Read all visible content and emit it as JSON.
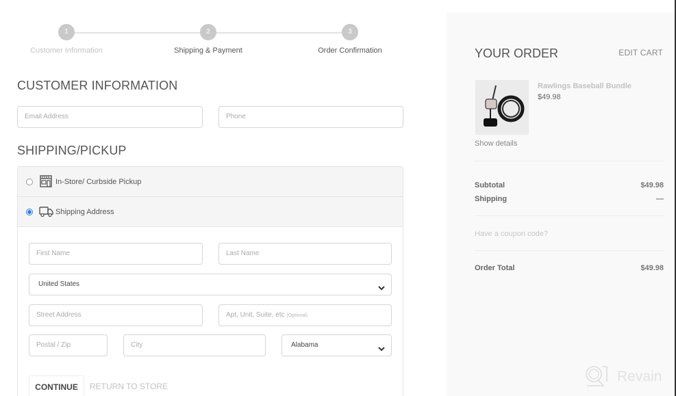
{
  "steps": [
    {
      "number": "1",
      "label": "Customer Information",
      "state": "done"
    },
    {
      "number": "2",
      "label": "Shipping & Payment",
      "state": "current"
    },
    {
      "number": "3",
      "label": "Order Confirmation",
      "state": "upcoming"
    }
  ],
  "customer": {
    "heading": "CUSTOMER INFORMATION",
    "email_placeholder": "Email Address",
    "phone_placeholder": "Phone"
  },
  "shipping": {
    "heading": "SHIPPING/PICKUP",
    "options": [
      {
        "label": "In-Store/ Curbside Pickup",
        "icon": "storefront-icon",
        "selected": false
      },
      {
        "label": "Shipping Address",
        "icon": "truck-icon",
        "selected": true
      }
    ],
    "first_name_placeholder": "First Name",
    "last_name_placeholder": "Last Name",
    "country_value": "United States",
    "street_placeholder": "Street Address",
    "apt_placeholder": "Apt, Unit, Suite, etc",
    "apt_optional": "(Optional)",
    "postal_placeholder": "Postal / Zip",
    "city_placeholder": "City",
    "state_value": "Alabama"
  },
  "actions": {
    "continue_label": "CONTINUE",
    "return_label": "RETURN TO STORE"
  },
  "order": {
    "title": "YOUR ORDER",
    "edit_label": "EDIT CART",
    "item": {
      "name": "Rawlings Baseball Bundle",
      "price": "$49.98",
      "details_label": "Show details"
    },
    "subtotal_label": "Subtotal",
    "subtotal_value": "$49.98",
    "shipping_label": "Shipping",
    "shipping_value": "—",
    "coupon_label": "Have a coupon code?",
    "total_label": "Order Total",
    "total_value": "$49.98"
  },
  "watermark": {
    "text": "Revain"
  },
  "colors": {
    "accent": "#2a7de1",
    "panel_bg": "#f9f9f9",
    "step_circle": "#c9c9c9"
  }
}
